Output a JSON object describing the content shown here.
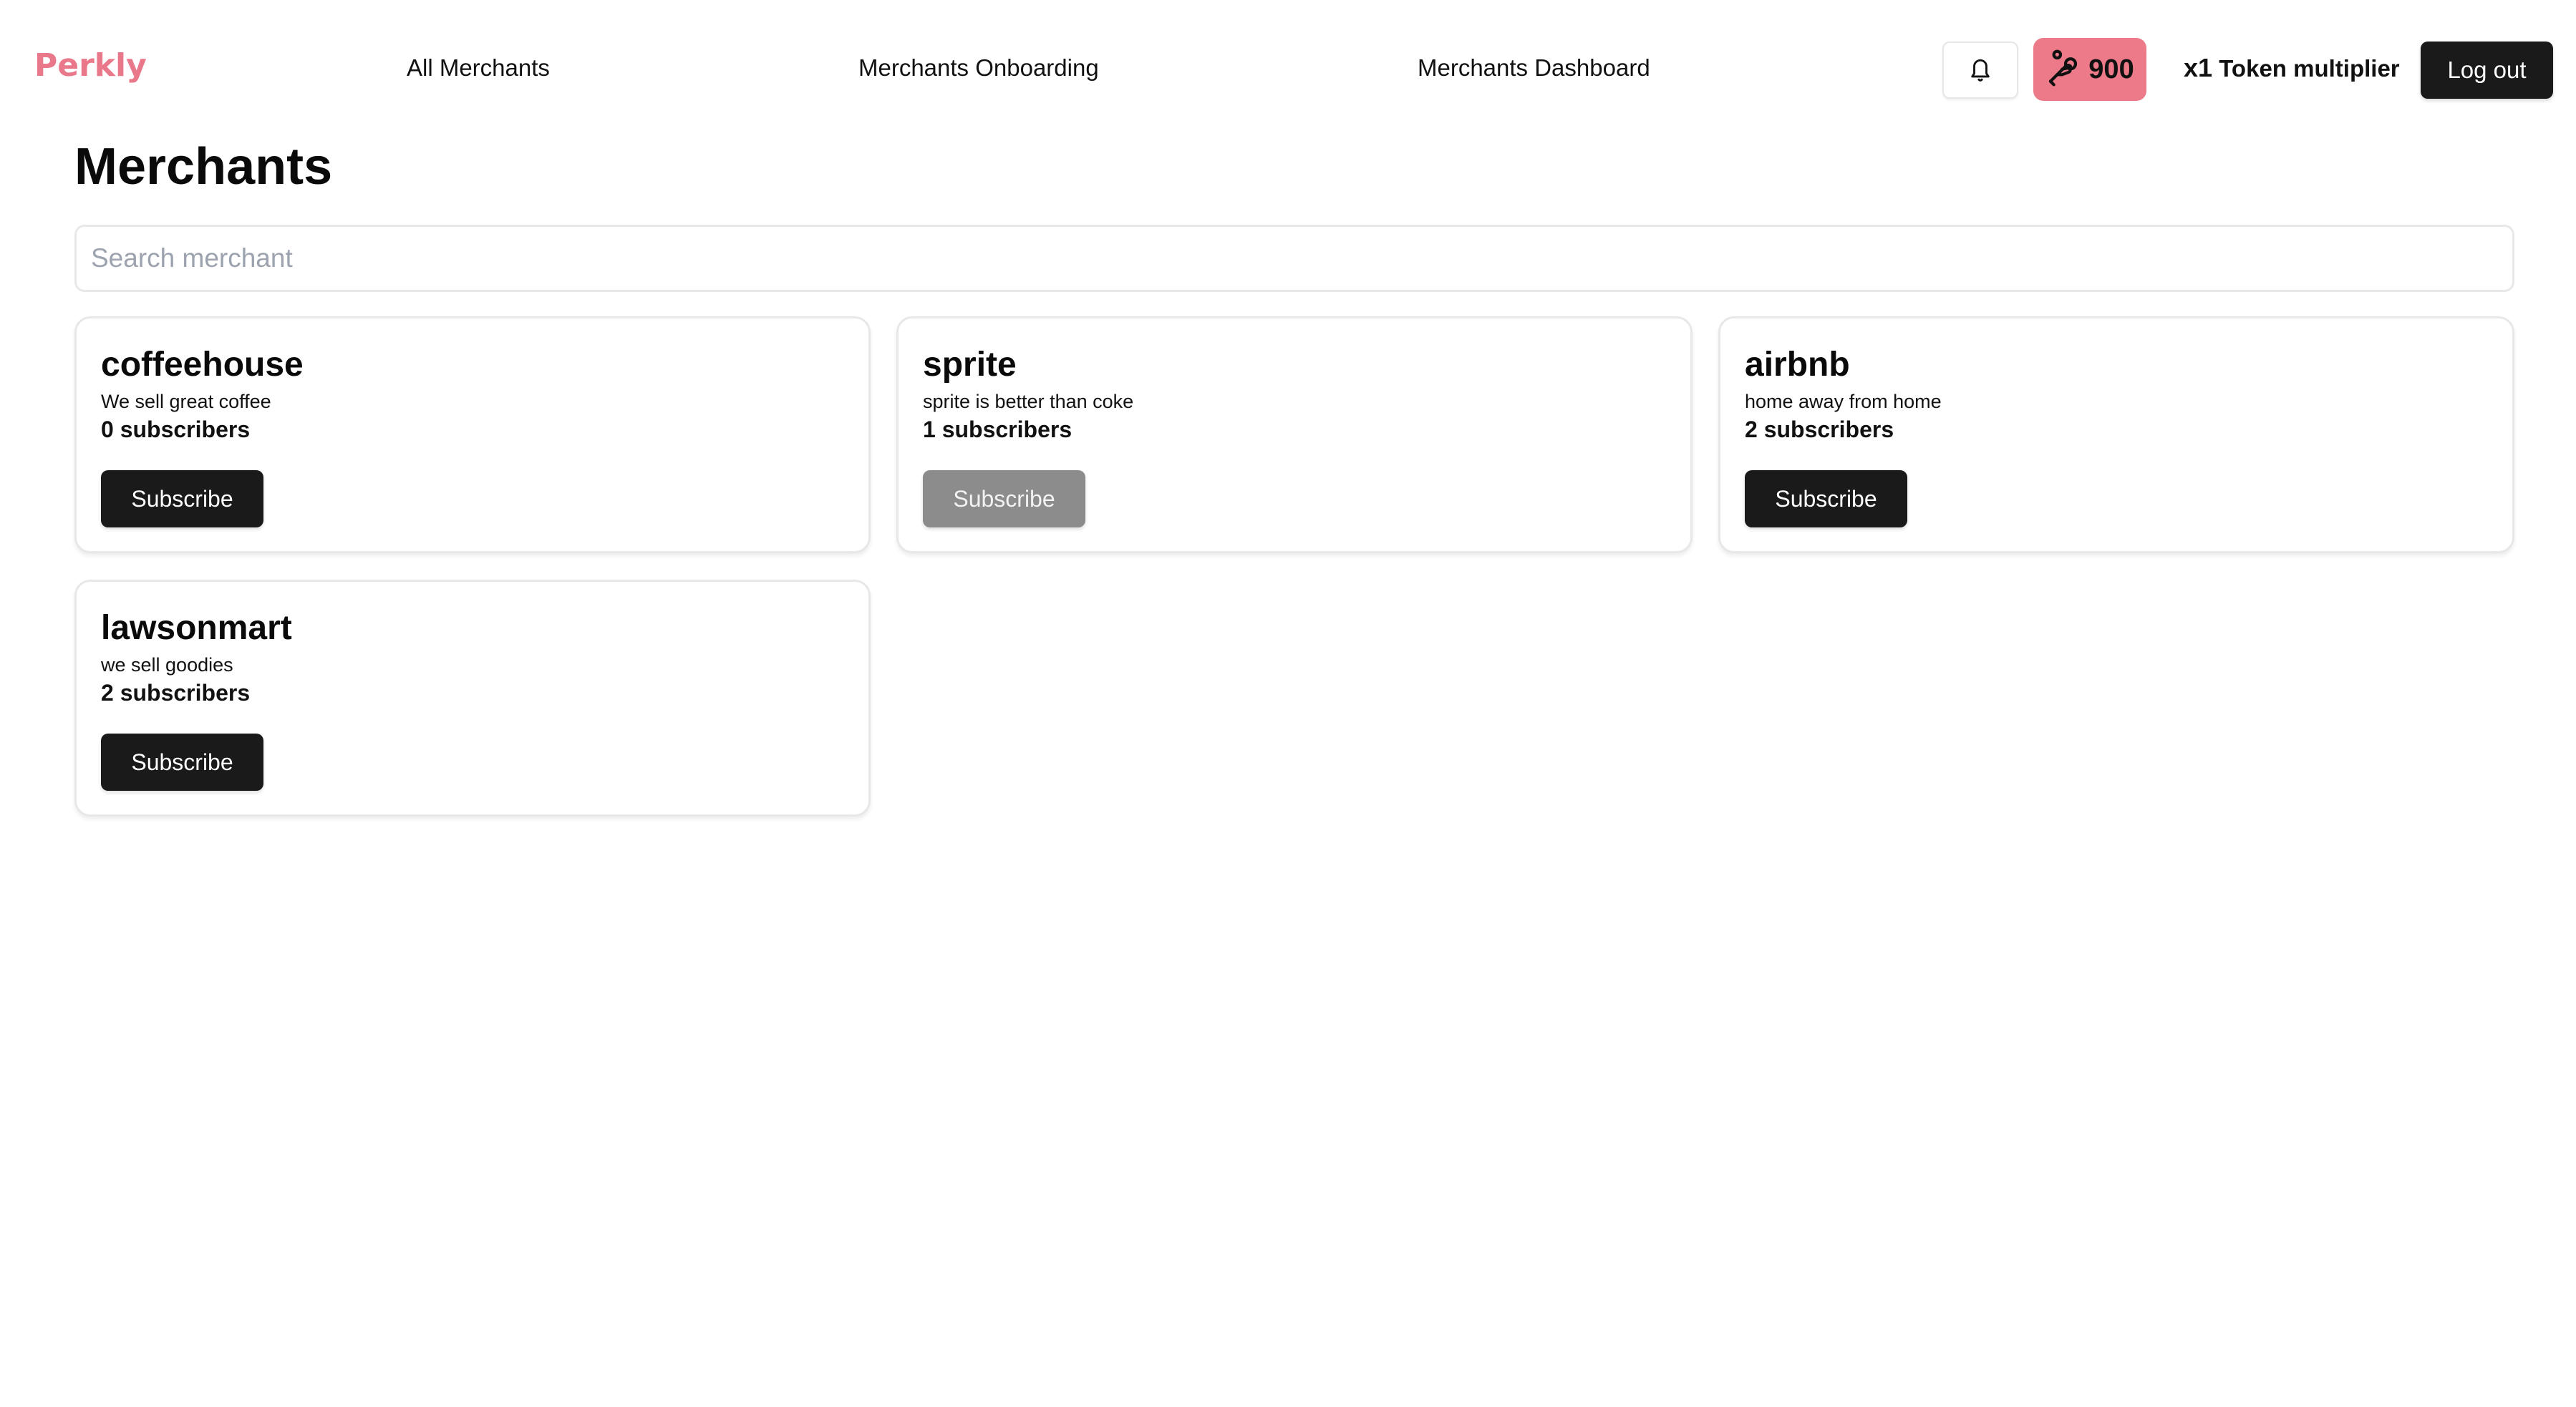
{
  "app": {
    "logo": "Perkly",
    "brand_color": "#E8788A"
  },
  "nav": {
    "links": [
      {
        "label": "All Merchants"
      },
      {
        "label": "Merchants Onboarding"
      },
      {
        "label": "Merchants Dashboard"
      }
    ],
    "notifications_icon": "bell-icon",
    "tokens": {
      "icon": "hand-coins-icon",
      "value": "900",
      "color": "#EC7A89"
    },
    "multiplier": {
      "prefix": "x1",
      "label": "Token multiplier"
    },
    "logout_label": "Log out"
  },
  "page": {
    "title": "Merchants",
    "search": {
      "placeholder": "Search merchant",
      "value": ""
    }
  },
  "merchants": [
    {
      "name": "coffeehouse",
      "description": "We sell great coffee",
      "subscribers": "0 subscribers",
      "button_label": "Subscribe",
      "subscribed": false
    },
    {
      "name": "sprite",
      "description": "sprite is better than coke",
      "subscribers": "1 subscribers",
      "button_label": "Subscribe",
      "subscribed": true
    },
    {
      "name": "airbnb",
      "description": "home away from home",
      "subscribers": "2 subscribers",
      "button_label": "Subscribe",
      "subscribed": false
    },
    {
      "name": "lawsonmart",
      "description": "we sell goodies",
      "subscribers": "2 subscribers",
      "button_label": "Subscribe",
      "subscribed": false
    }
  ]
}
